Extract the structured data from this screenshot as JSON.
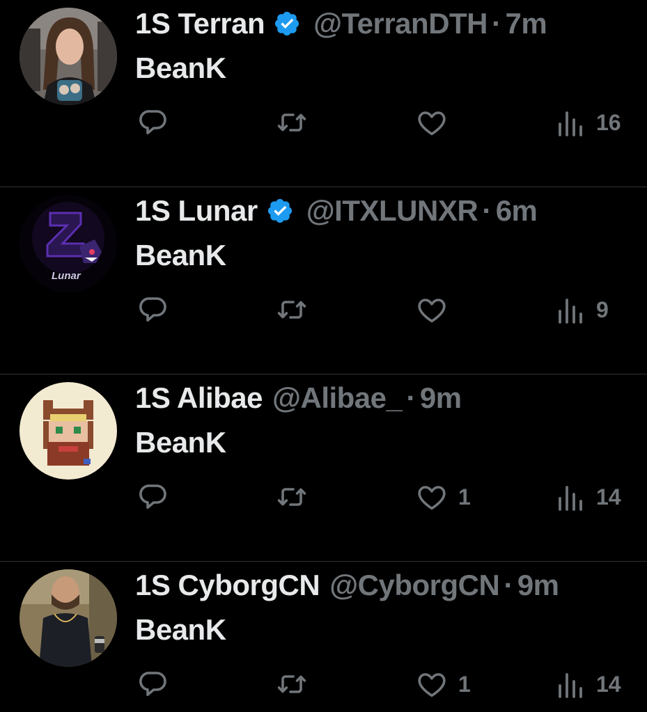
{
  "colors": {
    "background": "#000000",
    "text_primary": "#e7e9ea",
    "text_secondary": "#71767b",
    "verified_blue": "#1d9bf0",
    "divider": "#2f3336"
  },
  "icons": {
    "reply": "reply-bubble-icon",
    "retweet": "retweet-arrows-icon",
    "like": "heart-icon",
    "views": "bar-chart-icon",
    "verified": "verified-badge-icon"
  },
  "separator": "·",
  "tweets": [
    {
      "display_name": "1S Terran",
      "verified": true,
      "handle": "@TerranDTH",
      "time": "7m",
      "text": "BeanK",
      "replies": "",
      "retweets": "",
      "likes": "",
      "views": "16"
    },
    {
      "display_name": "1S Lunar",
      "verified": true,
      "handle": "@ITXLUNXR",
      "time": "6m",
      "text": "BeanK",
      "avatar_text": "Lunar",
      "replies": "",
      "retweets": "",
      "likes": "",
      "views": "9"
    },
    {
      "display_name": "1S Alibae",
      "verified": false,
      "handle": "@Alibae_",
      "time": "9m",
      "text": "BeanK",
      "replies": "",
      "retweets": "",
      "likes": "1",
      "views": "14"
    },
    {
      "display_name": "1S CyborgCN",
      "verified": false,
      "handle": "@CyborgCN",
      "time": "9m",
      "text": "BeanK",
      "replies": "",
      "retweets": "",
      "likes": "1",
      "views": "14"
    }
  ]
}
